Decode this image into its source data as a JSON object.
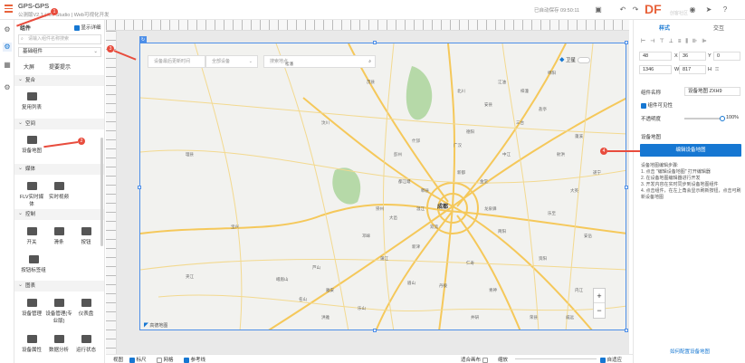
{
  "app": {
    "title": "GPS-GPS",
    "subtitle": "公测版V2.1 | IoT Studio | Web可视化开发",
    "save_status": "已自动保存 09:50:11"
  },
  "brand": {
    "logo_text": "DF",
    "logo_sub": "创客社区",
    "logo_color": "#e8623a"
  },
  "left_panel": {
    "header": "组件",
    "show_detail_label": "显示详细",
    "search_placeholder": "请输入组件名称搜索",
    "category_select": "基础组件",
    "tabs": [
      "大屏",
      "提要提示"
    ],
    "sections": [
      {
        "name": "复合",
        "items": [
          "复用列表"
        ]
      },
      {
        "name": "空间",
        "items": [
          "设备地图"
        ]
      },
      {
        "name": "媒体",
        "items": [
          "FLV实时媒体",
          "实时视频"
        ]
      },
      {
        "name": "控制",
        "items": [
          "开关",
          "滑条",
          "按钮",
          "按钮标签组"
        ]
      },
      {
        "name": "图表",
        "items": [
          "设备管理",
          "设备管理(专业版)",
          "仪表盘",
          "设备属性",
          "数据分析",
          "运行状态"
        ]
      }
    ]
  },
  "map": {
    "device_time_placeholder": "设备最后更新时间",
    "device_select": "全部设备",
    "search_placeholder": "搜索地点",
    "satellite_label": "卫星",
    "zoom_in": "+",
    "zoom_out": "−",
    "attribution": "高德地图",
    "center_city": "成都",
    "cities": [
      "绵阳",
      "德阳",
      "广汉",
      "什邡",
      "彭州",
      "金堂",
      "简阳",
      "资阳",
      "眉山",
      "乐山",
      "内江",
      "雅安",
      "崇州",
      "邛崃",
      "大邑",
      "蒲江",
      "丹棱",
      "青神",
      "夹江",
      "峨眉山",
      "洪雅",
      "名山",
      "芦山",
      "宝兴",
      "汶川",
      "理县",
      "都江堰",
      "郫县",
      "新都",
      "温江",
      "双流",
      "新津",
      "龙泉驿",
      "仁寿",
      "井研",
      "威远",
      "荣县",
      "乐至",
      "安岳",
      "遂宁",
      "中江",
      "三台",
      "盐亭",
      "射洪",
      "大英",
      "蓬溪",
      "梓潼",
      "江油",
      "安县",
      "北川",
      "茂县",
      "松潘"
    ]
  },
  "right_panel": {
    "tabs": [
      "样式",
      "交互"
    ],
    "x_label": "X",
    "x_value": "48",
    "y_label": "Y",
    "y_value": "36",
    "rot_value": "0",
    "w_label": "W",
    "w_value": "1346",
    "h_label": "H",
    "h_value": "817",
    "component_name_label": "组件名称",
    "component_name_value": "设备地图 ZXH9",
    "visible_label": "组件可见性",
    "opacity_label": "不透明度",
    "opacity_value": "100%",
    "section_title": "设备地图",
    "edit_button": "编辑设备地图",
    "help_title": "设备地图编辑步骤:",
    "help_steps": [
      "1. 点击 \"编辑设备地图\" 打开编辑器",
      "2. 在设备地图编辑器进行开发",
      "3. 开发内容在实时同步到设备地图组件",
      "4. 点击组件，在左上角会显示刷新按钮，点击可刷新设备地图"
    ],
    "footer_link": "如何配置设备地图"
  },
  "bottom_bar": {
    "view_label": "视图",
    "ruler_label": "标尺",
    "grid_label": "网格",
    "guide_label": "参考线",
    "fit_label": "适合画布",
    "zoom_label": "缩放",
    "auto_fit_label": "自适应"
  },
  "annotations": [
    "1",
    "2",
    "3",
    "4"
  ],
  "colors": {
    "accent": "#1677d2",
    "annotation": "#e84c3d",
    "road": "#f5c85a",
    "green": "#b6d9a8"
  }
}
